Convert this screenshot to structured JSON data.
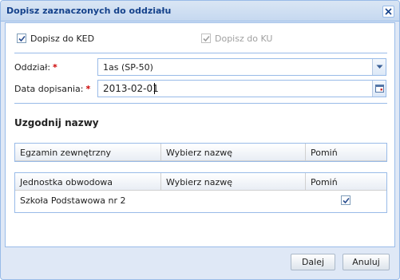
{
  "dialog": {
    "title": "Dopisz zaznaczonych do oddziału"
  },
  "options": {
    "ked_label": "Dopisz do KED",
    "ked_checked": true,
    "ku_label": "Dopisz do KU",
    "ku_checked": true,
    "ku_disabled": true
  },
  "form": {
    "oddzial_label": "Oddział:",
    "oddzial_value": "1as (SP-50)",
    "data_label": "Data dopisania:",
    "data_value": "2013-02-01",
    "required_mark": "*"
  },
  "section": {
    "title": "Uzgodnij nazwy"
  },
  "grid_exam": {
    "columns": [
      "Egzamin zewnętrzny",
      "Wybierz nazwę",
      "Pomiń"
    ],
    "rows": []
  },
  "grid_unit": {
    "columns": [
      "Jednostka obwodowa",
      "Wybierz nazwę",
      "Pomiń"
    ],
    "rows": [
      {
        "name": "Szkoła Podstawowa nr 2",
        "choice": "",
        "skip": true
      }
    ]
  },
  "buttons": {
    "next": "Dalej",
    "cancel": "Anuluj"
  },
  "colors": {
    "accent": "#15428b",
    "border": "#99bbe8",
    "required": "#cc0000"
  }
}
